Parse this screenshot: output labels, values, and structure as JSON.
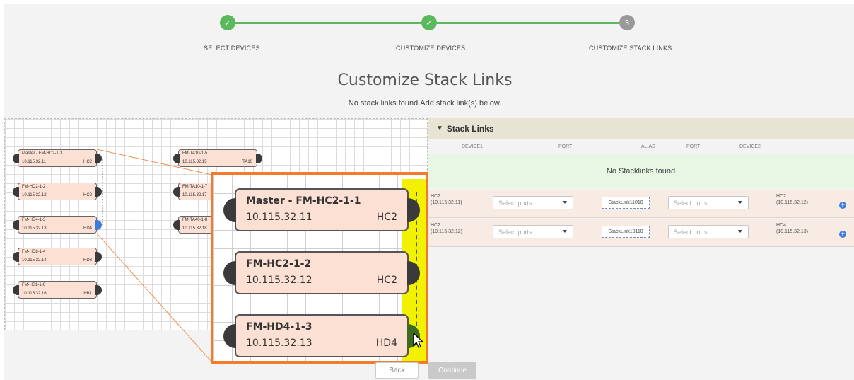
{
  "stepper": {
    "steps": [
      {
        "label": "SELECT DEVICES",
        "state": "done",
        "icon": "check-icon",
        "symbol": "✓"
      },
      {
        "label": "CUSTOMIZE DEVICES",
        "state": "done",
        "icon": "check-icon",
        "symbol": "✓"
      },
      {
        "label": "CUSTOMIZE STACK LINKS",
        "state": "current",
        "number": "3"
      }
    ],
    "done_color": "#5cb85c",
    "current_color": "#999999"
  },
  "page": {
    "title": "Customize Stack Links",
    "subtitle": "No stack links found.Add stack link(s) below."
  },
  "topology": {
    "nodes": [
      {
        "name": "Master - FM-HC2-1-1",
        "ip": "10.115.32.11",
        "tag": "HC2"
      },
      {
        "name": "FM-HC2-1-2",
        "ip": "10.115.32.12",
        "tag": "HC2"
      },
      {
        "name": "FM-HD4-1-3",
        "ip": "10.115.32.13",
        "tag": "HD4"
      },
      {
        "name": "FM-HD8-1-4",
        "ip": "10.115.32.14",
        "tag": "HD8"
      },
      {
        "name": "FM-HB1-1-6",
        "ip": "10.115.32.16",
        "tag": "HB1"
      },
      {
        "name": "FM-TA10-1-5",
        "ip": "10.115.32.15",
        "tag": "TA10"
      },
      {
        "name": "FM-TA10-1-7",
        "ip": "10.115.32.17",
        "tag": ""
      },
      {
        "name": "FM-TA40-1-8",
        "ip": "10.115.32.18",
        "tag": ""
      }
    ],
    "zoom_nodes": [
      {
        "name": "Master - FM-HC2-1-1",
        "ip": "10.115.32.11",
        "tag": "HC2"
      },
      {
        "name": "FM-HC2-1-2",
        "ip": "10.115.32.12",
        "tag": "HC2"
      },
      {
        "name": "FM-HD4-1-3",
        "ip": "10.115.32.13",
        "tag": "HD4"
      }
    ],
    "highlight_color": "#f2f200",
    "callout_color": "#f47b2c"
  },
  "stack_links": {
    "header": "Stack Links",
    "columns": {
      "device1": "DEVICE1",
      "port1": "PORT",
      "alias": "ALIAS",
      "port2": "PORT",
      "device2": "DEVICE2"
    },
    "empty_message": "No Stacklinks found",
    "rows": [
      {
        "device1": "HC2",
        "device1_ip": "(10.115.32.11)",
        "port1_placeholder": "Select ports...",
        "alias": "StackLink11010",
        "port2_placeholder": "Select ports...",
        "device2": "HC2",
        "device2_ip": "(10.115.32.12)",
        "add": "+"
      },
      {
        "device1": "HC2",
        "device1_ip": "(10.115.32.12)",
        "port1_placeholder": "Select ports...",
        "alias": "StackLink10110",
        "port2_placeholder": "Select ports...",
        "device2": "HD4",
        "device2_ip": "(10.115.32.13)",
        "add": "+"
      }
    ]
  },
  "footer": {
    "back_label": "Back",
    "continue_label": "Continue"
  }
}
